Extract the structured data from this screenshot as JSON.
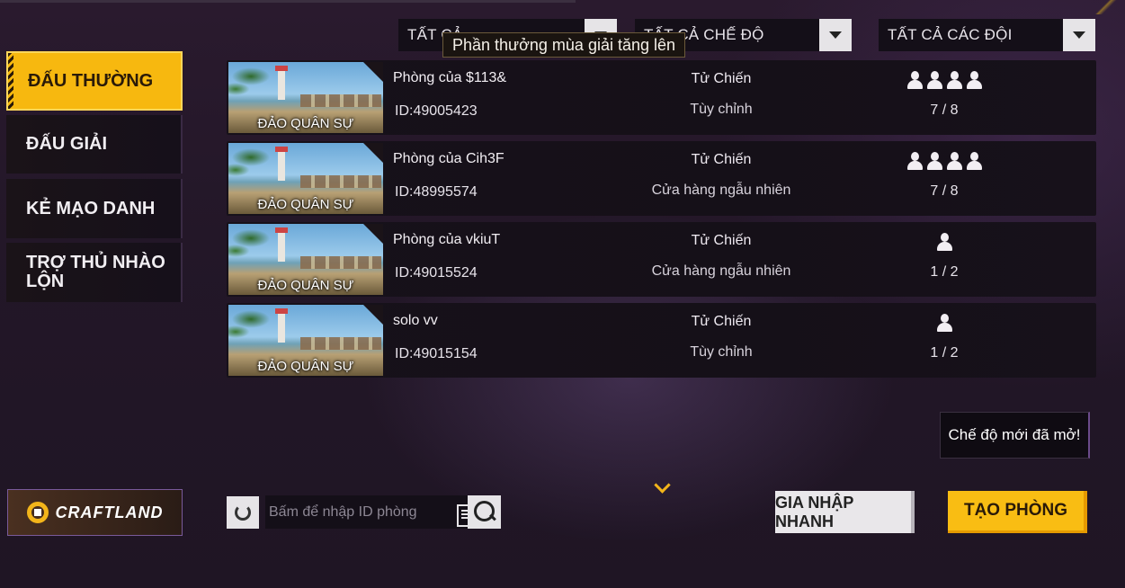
{
  "filters": {
    "type": "TẤT CẢ",
    "mode": "TẤT CẢ CHẾ ĐỘ",
    "teams": "TẤT CẢ CÁC ĐỘI"
  },
  "tooltip": "Phần thưởng mùa giải tăng lên",
  "nav": [
    {
      "label": "ĐẤU THƯỜNG",
      "active": true
    },
    {
      "label": "ĐẤU GIẢI",
      "active": false
    },
    {
      "label": "KẺ MẠO DANH",
      "active": false
    },
    {
      "label": "TRỢ THỦ NHÀO LỘN",
      "active": false
    }
  ],
  "rooms": [
    {
      "map": "ĐẢO QUÂN SỰ",
      "name": "Phòng của $113&",
      "id": "ID:49005423",
      "mode": "Tử Chiến",
      "sub": "Tùy chỉnh",
      "count": "7 / 8",
      "player_icons": 4
    },
    {
      "map": "ĐẢO QUÂN SỰ",
      "name": "Phòng của Cih3F",
      "id": "ID:48995574",
      "mode": "Tử Chiến",
      "sub": "Cửa hàng ngẫu nhiên",
      "count": "7 / 8",
      "player_icons": 4
    },
    {
      "map": "ĐẢO QUÂN SỰ",
      "name": "Phòng của vkiuT",
      "id": "ID:49015524",
      "mode": "Tử Chiến",
      "sub": "Cửa hàng ngẫu nhiên",
      "count": "1 / 2",
      "player_icons": 1
    },
    {
      "map": "ĐẢO QUÂN SỰ",
      "name": "solo vv",
      "id": "ID:49015154",
      "mode": "Tử Chiến",
      "sub": "Tùy chỉnh",
      "count": "1 / 2",
      "player_icons": 1
    }
  ],
  "new_mode_notice": "Chế độ mới đã mở!",
  "craftland": "CRAFTLAND",
  "search": {
    "placeholder": "Bấm để nhập ID phòng",
    "value": ""
  },
  "buttons": {
    "quick_join": "GIA NHẬP NHANH",
    "create_room": "TẠO PHÒNG"
  },
  "colors": {
    "accent": "#f9bd13",
    "panel": "#151018"
  }
}
